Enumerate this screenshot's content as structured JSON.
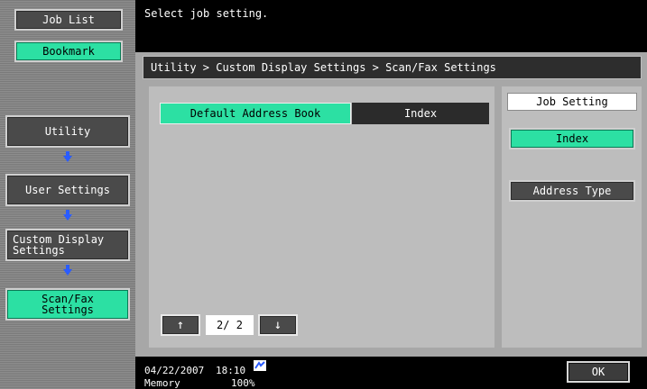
{
  "left_panel": {
    "job_list_label": "Job List",
    "bookmark_label": "Bookmark",
    "utility_label": "Utility",
    "user_settings_label": "User Settings",
    "custom_display_label": "Custom Display Settings",
    "scan_fax_label": "Scan/Fax Settings"
  },
  "message": {
    "text": "Select job setting."
  },
  "breadcrumb": {
    "text": "Utility > Custom Display Settings > Scan/Fax Settings"
  },
  "tabs": {
    "active_label": "Default Address Book",
    "inactive_label": "Index"
  },
  "pager": {
    "count": "2/ 2",
    "up_icon": "up-arrow-icon",
    "down_icon": "down-arrow-icon"
  },
  "right_panel": {
    "title": "Job Setting",
    "index_label": "Index",
    "address_type_label": "Address Type"
  },
  "footer": {
    "date": "04/22/2007",
    "time": "18:10",
    "memory_label": "Memory",
    "memory_value": "100%",
    "ok_label": "OK"
  },
  "colors": {
    "accent": "#2ce0a3",
    "dark": "#4a4a4a",
    "arrow": "#2a5cff"
  }
}
